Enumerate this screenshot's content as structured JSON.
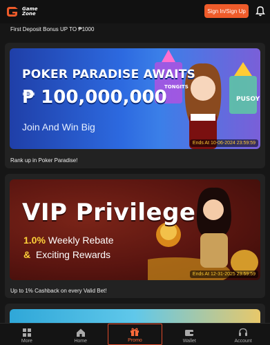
{
  "header": {
    "logo_text_line1": "Game",
    "logo_text_line2": "Zone",
    "signin_label": "Sign In/Sign Up",
    "bell_icon": "bell-icon",
    "accent": "#ee5b2a"
  },
  "promos": [
    {
      "title": "First Deposit Bonus UP TO ₱1000"
    },
    {
      "headline": "POKER PARADISE AWAITS",
      "amount": "₱ 100,000,000",
      "subline": "Join And Win Big",
      "ends": "Ends At 10-06-2024 23:59:59",
      "caption": "Rank up in Poker Paradise!"
    },
    {
      "headline": "VIP Privilege",
      "line1_highlight": "1.0%",
      "line1_rest": " Weekly Rebate",
      "line2_amp": "&",
      "line2_rest": "  Exciting Rewards",
      "ends": "Ends At 12-31-2025 23:59:59",
      "caption": "Up to 1% Cashback on every Valid Bet!"
    }
  ],
  "nav": [
    {
      "label": "More",
      "icon": "grid-icon"
    },
    {
      "label": "Home",
      "icon": "home-icon"
    },
    {
      "label": "Promo",
      "icon": "gift-icon",
      "active": true
    },
    {
      "label": "Wallet",
      "icon": "wallet-icon"
    },
    {
      "label": "Account",
      "icon": "headset-icon"
    }
  ]
}
